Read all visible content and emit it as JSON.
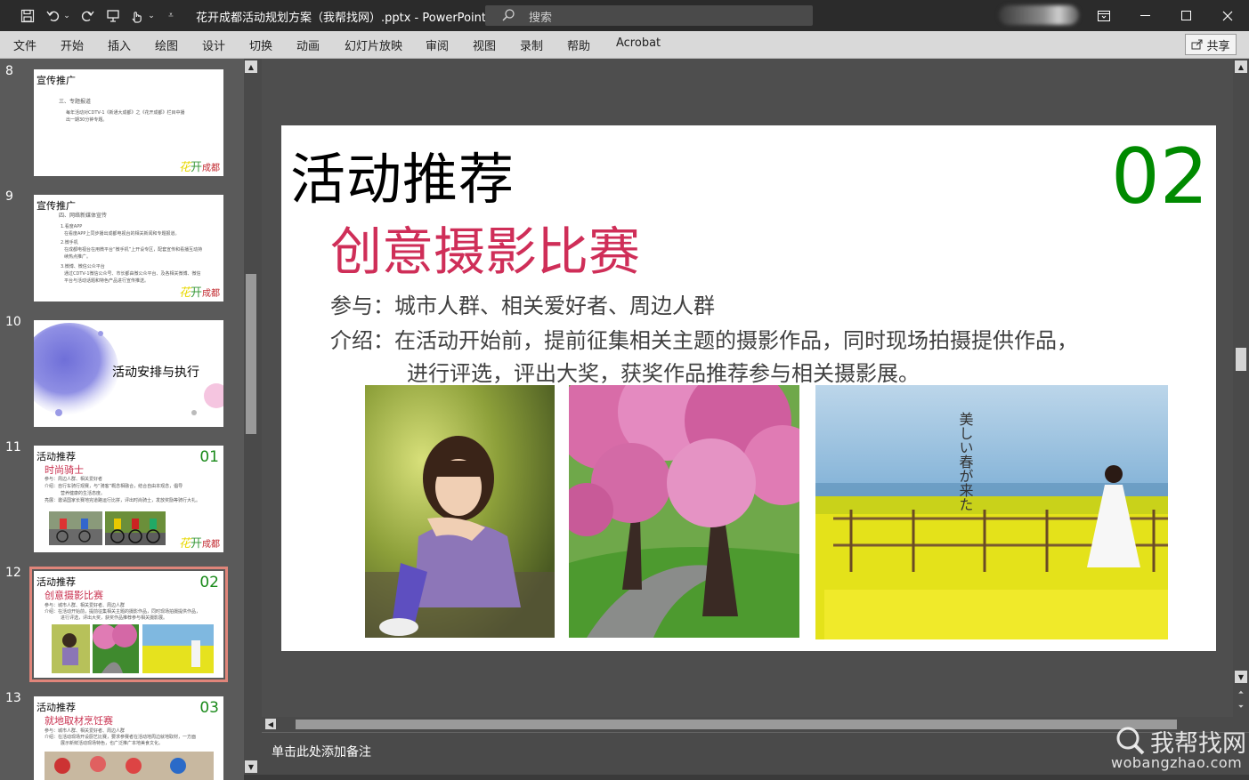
{
  "window": {
    "title": "花开成都活动规划方案（我帮找网）.pptx  -  PowerPoint",
    "search_placeholder": "搜索",
    "share_label": "共享"
  },
  "ribbon": {
    "tabs": [
      "文件",
      "开始",
      "插入",
      "绘图",
      "设计",
      "切换",
      "动画",
      "幻灯片放映",
      "审阅",
      "视图",
      "录制",
      "帮助",
      "Acrobat"
    ]
  },
  "thumbnails": [
    {
      "num": "8",
      "heading": "宣传推广",
      "lines": [
        "三、专题报道",
        "每年活动对CDTV-1《新通大成都》之《花开成都》栏目中播",
        "出一期30分钟专题。"
      ],
      "logo": {
        "a": "花",
        "b": "开",
        "c": "成都"
      }
    },
    {
      "num": "9",
      "heading": "宣传推广",
      "lines": [
        "四、网络新媒体宣传",
        "1.看度APP",
        "在看度APP上同步播出成都电视台的相关新闻和专题报道。",
        "2.微手机",
        "在成都电视台在用微平台“微手机”上开设专区，配套宣传和看播互动持",
        "续热点推广。",
        "3.微博、微信公众平台",
        "通过CDTV-1微信公众号、市长都由微公众平台、及各相关微博、微信",
        "平台与活动话题和特色产品进行宣传推送。"
      ],
      "logo": {
        "a": "花",
        "b": "开",
        "c": "成都"
      }
    },
    {
      "num": "10",
      "heading": "活动安排与执行"
    },
    {
      "num": "11",
      "heading": "活动推荐",
      "number": "01",
      "subtitle": "时尚骑士",
      "lines": [
        "参与：周边人群、相关爱好者",
        "介绍：自行车骑行观赛，与“骑客”概念相融合，结合自由本观念，倡导",
        "营养健康的生活态度。",
        "亮展：邀请国家长赛地完道路运行比拼，评出时尚骑士，发放奖励等骑行大礼。"
      ],
      "logo": {
        "a": "花",
        "b": "开",
        "c": "成都"
      }
    },
    {
      "num": "12",
      "heading": "活动推荐",
      "number": "02",
      "subtitle": "创意摄影比赛",
      "lines": [
        "参与：城市人群、相关爱好者、周边人群",
        "介绍：在活动开始前，提前征集相关主题的摄影作品，同时现场拍摄提供作品，",
        "进行评选，评出大奖，获奖作品推荐参与相关摄影展。"
      ]
    },
    {
      "num": "13",
      "heading": "活动推荐",
      "number": "03",
      "subtitle": "就地取材烹饪赛",
      "lines": [
        "参与：城市人群、相关爱好者、周边人群",
        "介绍：在活动现场开设厨艺比赛，要求参赛者在活动地周边就地取材，一方面",
        "展示新鲜活动现场特色，也广泛推广本地美食文化。"
      ]
    }
  ],
  "slide": {
    "title": "活动推荐",
    "number": "02",
    "subtitle": "创意摄影比赛",
    "participants": "参与：城市人群、相关爱好者、周边人群",
    "intro_line1": "介绍：在活动开始前，提前征集相关主题的摄影作品，同时现场拍摄提供作品，",
    "intro_line2": "进行评选，评出大奖，获奖作品推荐参与相关摄影展。",
    "photo3_caption": "美しい春が来た"
  },
  "notes_placeholder": "单击此处添加备注",
  "watermark": {
    "name": "我帮找网",
    "url": "wobangzhao.com"
  }
}
